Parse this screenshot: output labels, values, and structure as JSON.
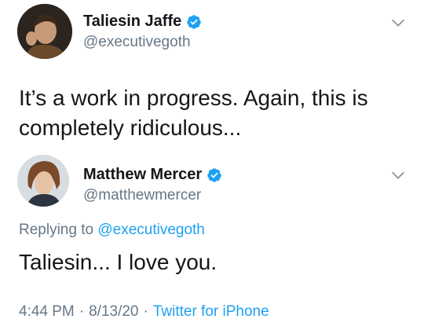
{
  "colors": {
    "text": "#14171a",
    "secondary": "#657786",
    "link": "#1da1f2",
    "verified": "#1da1f2"
  },
  "original_tweet": {
    "display_name": "Taliesin Jaffe",
    "handle": "@executivegoth",
    "verified_icon": "verified-badge-icon",
    "text": "It’s a work in progress. Again, this is completely ridiculous..."
  },
  "reply_tweet": {
    "display_name": "Matthew Mercer",
    "handle": "@matthewmercer",
    "verified_icon": "verified-badge-icon",
    "replying_prefix": "Replying to",
    "replying_handle": "@executivegoth",
    "text": "Taliesin... I love you.",
    "time": "4:44 PM",
    "separator": "·",
    "date": "8/13/20",
    "source": "Twitter for iPhone"
  }
}
